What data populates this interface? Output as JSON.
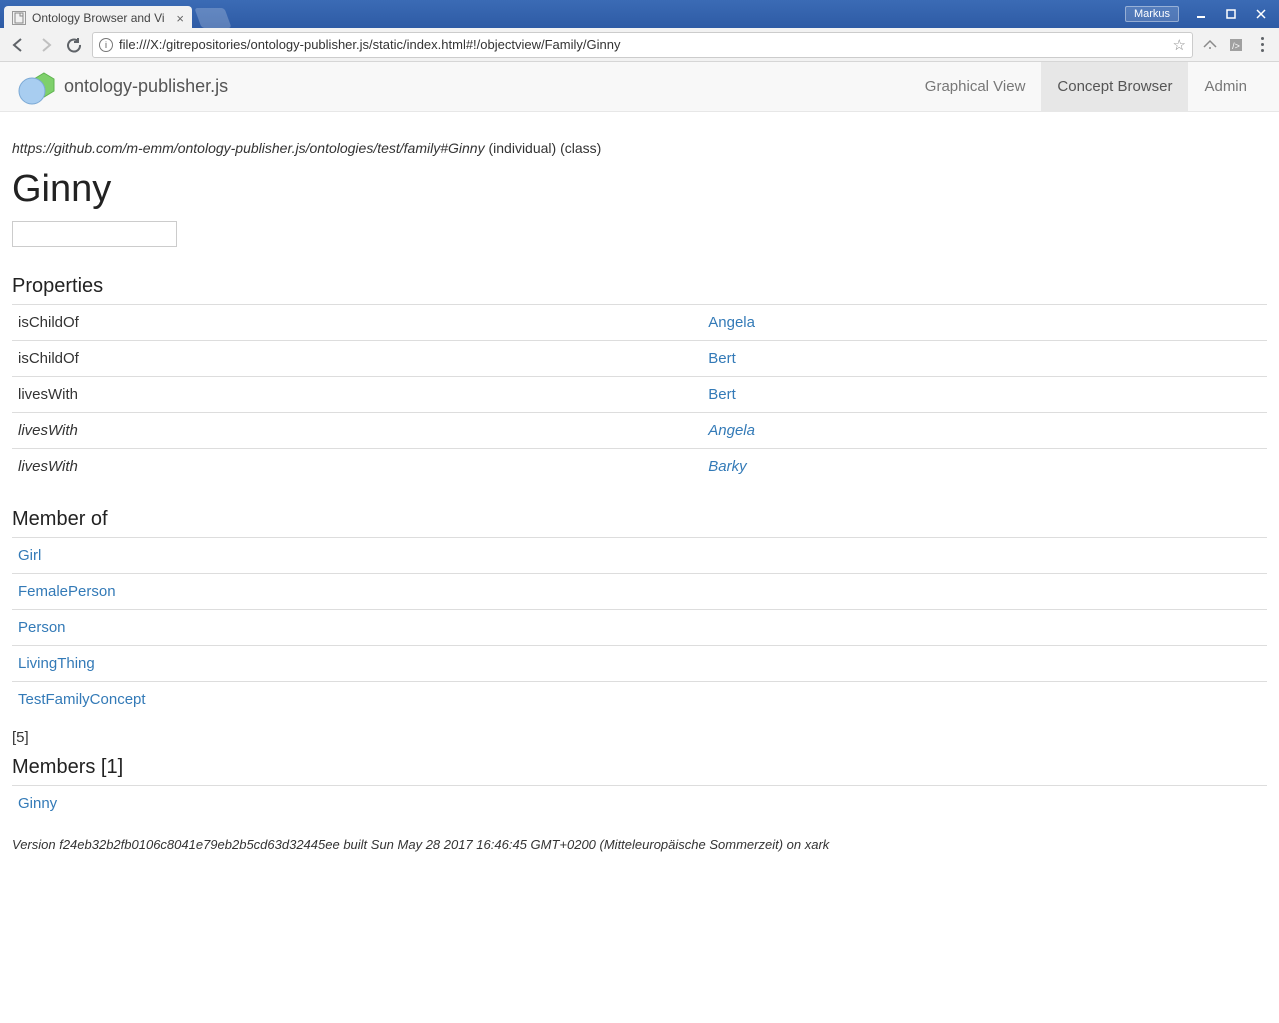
{
  "window": {
    "user_badge": "Markus"
  },
  "browser": {
    "tab_title": "Ontology Browser and Vi",
    "url": "file:///X:/gitrepositories/ontology-publisher.js/static/index.html#!/objectview/Family/Ginny"
  },
  "app": {
    "brand": "ontology-publisher.js",
    "nav": {
      "graphical": "Graphical View",
      "browser": "Concept Browser",
      "admin": "Admin"
    }
  },
  "entity": {
    "iri": "https://github.com/m-emm/ontology-publisher.js/ontologies/test/family#Ginny",
    "type_individual": "(individual)",
    "type_class": "(class)",
    "title": "Ginny"
  },
  "sections": {
    "properties": "Properties",
    "member_of": "Member of",
    "members_count_bracket": "[5]",
    "members": "Members [1]"
  },
  "properties": [
    {
      "key": "isChildOf",
      "val": "Angela",
      "italic": false
    },
    {
      "key": "isChildOf",
      "val": "Bert",
      "italic": false
    },
    {
      "key": "livesWith",
      "val": "Bert",
      "italic": false
    },
    {
      "key": "livesWith",
      "val": "Angela",
      "italic": true
    },
    {
      "key": "livesWith",
      "val": "Barky",
      "italic": true
    }
  ],
  "member_of": [
    "Girl",
    "FemalePerson",
    "Person",
    "LivingThing",
    "TestFamilyConcept"
  ],
  "members": [
    "Ginny"
  ],
  "footer": {
    "version": "Version f24eb32b2fb0106c8041e79eb2b5cd63d32445ee built Sun May 28 2017 16:46:45 GMT+0200 (Mitteleuropäische Sommerzeit) on xark"
  }
}
